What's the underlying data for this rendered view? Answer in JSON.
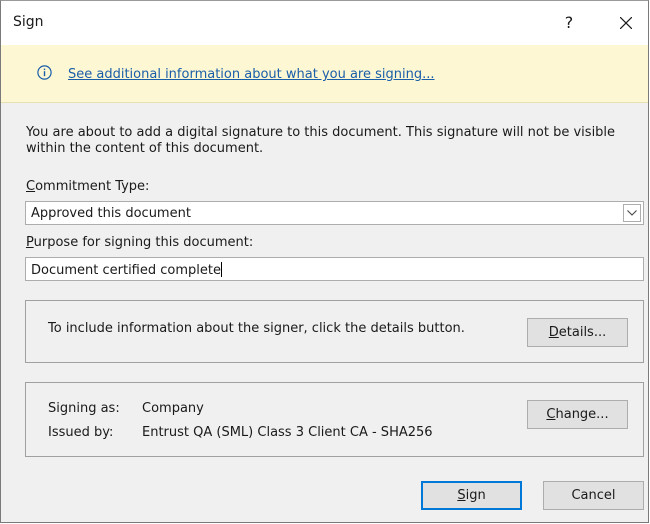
{
  "window": {
    "title": "Sign",
    "help_label": "?"
  },
  "info_bar": {
    "link_text": "See additional information about what you are signing..."
  },
  "description": "You are about to add a digital signature to this document. This signature will not be visible within the content of this document.",
  "commitment": {
    "label_key": "C",
    "label_rest": "ommitment Type:",
    "selected": "Approved this document"
  },
  "purpose": {
    "label_key": "P",
    "label_rest": "urpose for signing this document:",
    "value": "Document certified complete"
  },
  "details_panel": {
    "text": "To include information about the signer, click the details button.",
    "button_key": "D",
    "button_rest": "etails..."
  },
  "signer_panel": {
    "signing_as_label": "Signing as:",
    "signing_as_value": "Company",
    "issued_by_label": "Issued by:",
    "issued_by_value": "Entrust QA (SML) Class 3 Client CA - SHA256",
    "change_key": "C",
    "change_rest": "hange..."
  },
  "footer": {
    "sign_key": "S",
    "sign_rest": "ign",
    "cancel_label": "Cancel"
  },
  "colors": {
    "accent": "#0078d7",
    "link": "#1a5ea8",
    "info_bg": "#fdf7d4",
    "dialog_bg": "#f0f0f0"
  },
  "icons": {
    "info": "info-circle-icon",
    "close": "close-icon",
    "dropdown": "chevron-down-icon"
  }
}
